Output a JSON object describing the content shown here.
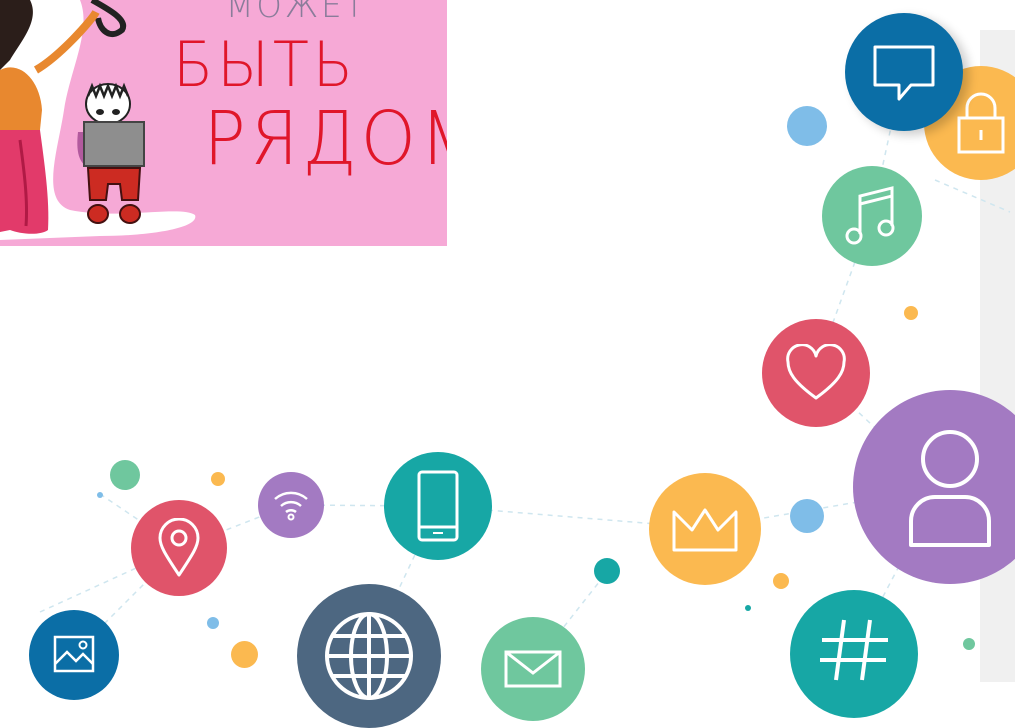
{
  "poster": {
    "text_top": "МОЖЕТ",
    "text_line1": "БЫТЬ",
    "text_line2": "РЯДОМ"
  },
  "icons": [
    {
      "name": "chat-icon",
      "color": "#0b6ea6"
    },
    {
      "name": "lock-icon",
      "color": "#fbb950"
    },
    {
      "name": "music-icon",
      "color": "#6fc79e"
    },
    {
      "name": "heart-icon",
      "color": "#e0546a"
    },
    {
      "name": "user-icon",
      "color": "#a37ac2"
    },
    {
      "name": "crown-icon",
      "color": "#fbb950"
    },
    {
      "name": "hashtag-icon",
      "color": "#17a7a5"
    },
    {
      "name": "mobile-icon",
      "color": "#17a7a5"
    },
    {
      "name": "wifi-icon",
      "color": "#a37ac2"
    },
    {
      "name": "location-icon",
      "color": "#e0546a"
    },
    {
      "name": "globe-icon",
      "color": "#4d6781"
    },
    {
      "name": "mail-icon",
      "color": "#6fc79e"
    },
    {
      "name": "image-icon",
      "color": "#0b6ea6"
    }
  ]
}
